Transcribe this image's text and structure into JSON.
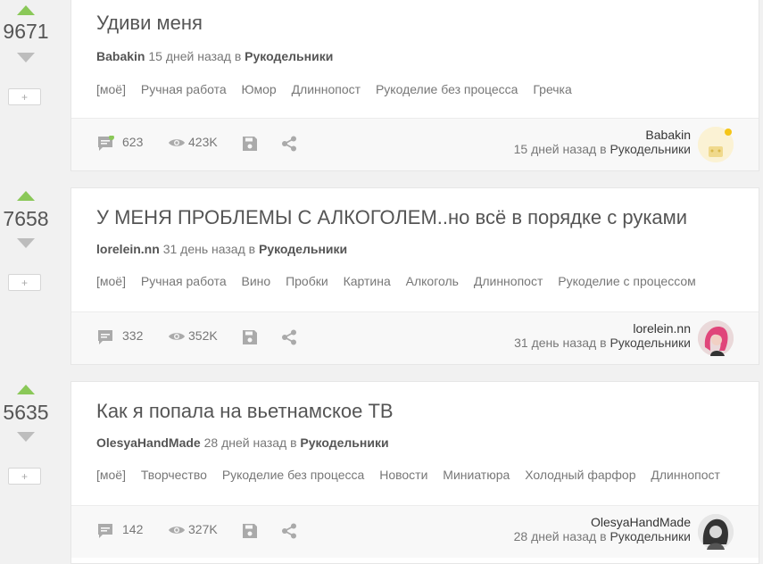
{
  "colors": {
    "upvote": "#8ac858",
    "downvote": "#bdbdbd",
    "online_dot": "#8ac858"
  },
  "posts": [
    {
      "score": "9671",
      "save_label": "+",
      "title": "Удиви меня",
      "author": "Babakin",
      "time": "15 дней назад",
      "in_label": "в",
      "community": "Рукодельники",
      "tags": [
        "[моё]",
        "Ручная работа",
        "Юмор",
        "Длиннопост",
        "Рукоделие без процесса",
        "Гречка"
      ],
      "comments": "623",
      "views": "423K",
      "avatar_icon": "yellow-avatar"
    },
    {
      "score": "7658",
      "save_label": "+",
      "title": "У МЕНЯ ПРОБЛЕМЫ С АЛКОГОЛЕМ..но всё в порядке с руками",
      "author": "lorelein.nn",
      "time": "31 день назад",
      "in_label": "в",
      "community": "Рукодельники",
      "tags": [
        "[моё]",
        "Ручная работа",
        "Вино",
        "Пробки",
        "Картина",
        "Алкоголь",
        "Длиннопост",
        "Рукоделие с процессом"
      ],
      "comments": "332",
      "views": "352K",
      "avatar_icon": "pink-hair-avatar"
    },
    {
      "score": "5635",
      "save_label": "+",
      "title": "Как я попала на вьетнамское ТВ",
      "author": "OlesyaHandMade",
      "time": "28 дней назад",
      "in_label": "в",
      "community": "Рукодельники",
      "tags": [
        "[моё]",
        "Творчество",
        "Рукоделие без процесса",
        "Новости",
        "Миниатюра",
        "Холодный фарфор",
        "Длиннопост"
      ],
      "comments": "142",
      "views": "327K",
      "avatar_icon": "bw-avatar"
    }
  ]
}
